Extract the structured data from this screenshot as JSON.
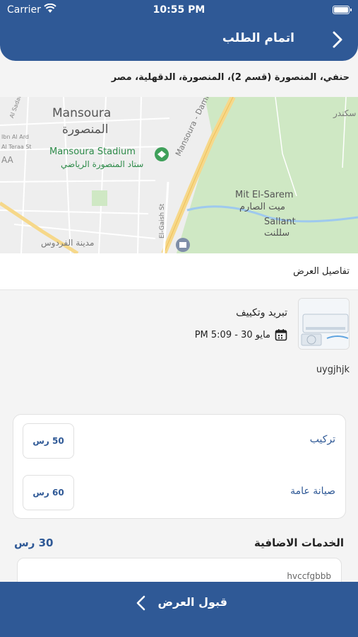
{
  "status_bar": {
    "carrier": "Carrier",
    "time": "10:55 PM"
  },
  "nav": {
    "title": "اتمام الطلب",
    "back_icon": "chevron-right-icon"
  },
  "address": "حنفي، المنصورة (قسم 2)، المنصورة، الدقهلية، مصر",
  "map": {
    "labels": {
      "city_en": "Mansoura",
      "city_ar": "المنصورة",
      "stadium_en": "Mansoura Stadium",
      "stadium_ar": "ستاد المنصورة الرياضي",
      "road": "Mansoura - Damietta Rd",
      "village1_en": "Mit El-Sarem",
      "village1_ar": "ميت الصارم",
      "village2_en": "Sallant",
      "village2_ar": "سللنت",
      "street": "El-Gaish St",
      "district_ar": "مدينة الفردوس",
      "side_label": "AA",
      "side_street1": "Al Sadat",
      "side_street2": "Al Teraa St",
      "side_street3": "Ibn Al Ard",
      "edge_ar": "سكندر"
    }
  },
  "offer_details": {
    "title": "تفاصيل العرض"
  },
  "service": {
    "name": "تبريد وتكييف",
    "date": "مايو 30 - 5:09 PM",
    "note": "uygjhjk",
    "calendar_icon": "calendar-icon"
  },
  "services": [
    {
      "label": "تركيب",
      "price": "50 رس"
    },
    {
      "label": "صيانة عامة",
      "price": "60 رس"
    }
  ],
  "extras": {
    "title": "الخدمات الاضافية",
    "total": "30 رس",
    "item": "hvccfgbbb"
  },
  "accept": {
    "label": "قبول العرض",
    "icon": "chevron-left-icon"
  },
  "colors": {
    "primary": "#2f5996",
    "map_land": "#eeeeee",
    "map_green": "#cfe8c4",
    "road_yellow": "#f6d88a",
    "water": "#9ec9ee"
  }
}
